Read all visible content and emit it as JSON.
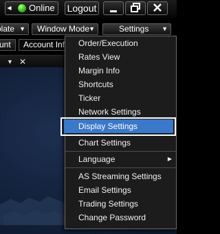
{
  "titlebar": {
    "online_label": "Online",
    "logout_label": "Logout",
    "minimize_icon": "minimize-icon",
    "restore_icon": "restore-icon",
    "close_icon": "close-icon"
  },
  "toolbar": {
    "template_label": "olate",
    "window_mode_label": "Window Mode",
    "settings_label": "Settings"
  },
  "tabs": {
    "account_label": "unt",
    "account_info_label": "Account Info"
  },
  "menu": {
    "items": [
      {
        "label": "Order/Execution"
      },
      {
        "label": "Rates View"
      },
      {
        "label": "Margin Info"
      },
      {
        "label": "Shortcuts"
      },
      {
        "label": "Ticker"
      },
      {
        "label": "Network Settings"
      },
      {
        "label": "Display Settings",
        "selected": true
      },
      {
        "label": "Chart Settings"
      },
      {
        "label": "Language",
        "has_submenu": true
      },
      {
        "label": "AS Streaming Settings"
      },
      {
        "label": "Email Settings"
      },
      {
        "label": "Trading Settings"
      },
      {
        "label": "Change Password"
      }
    ]
  },
  "colors": {
    "selection": "#3a78c9",
    "online_indicator": "#4fd42b",
    "workspace": "#13213b"
  }
}
